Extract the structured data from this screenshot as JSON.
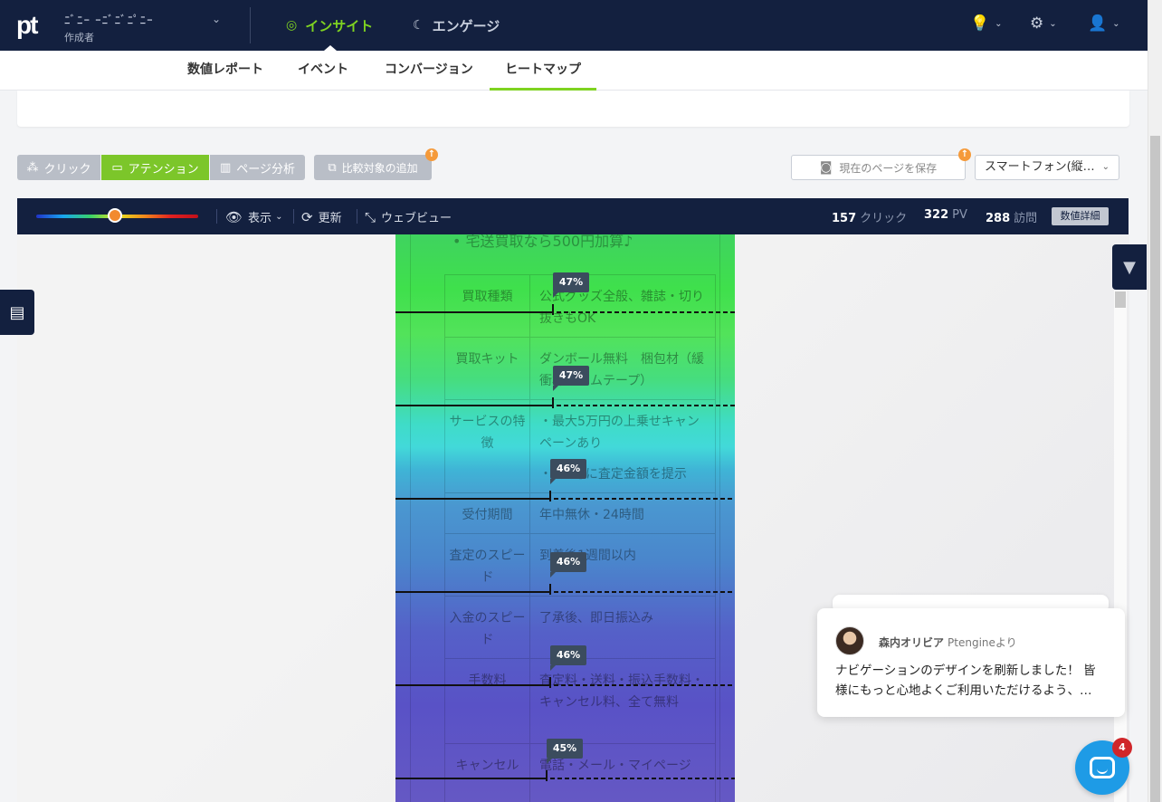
{
  "app": {
    "logo": "pt",
    "site_name": "ﾆﾞﾆｰ ｰﾆﾞﾆﾞﾆﾟﾆｰ",
    "site_role": "作成者"
  },
  "topnav": {
    "insight": "インサイト",
    "engage": "エンゲージ",
    "icons": [
      "lightbulb-icon",
      "gear-icon",
      "user-icon"
    ]
  },
  "subnav": {
    "tabs": [
      "数値レポート",
      "イベント",
      "コンバージョン",
      "ヒートマップ"
    ],
    "active": "ヒートマップ"
  },
  "toolbar": {
    "click": "クリック",
    "attention": "アテンション",
    "page_analysis": "ページ分析",
    "compare": "比較対象の追加",
    "save": "現在のページを保存",
    "device": "スマートフォン(縦…"
  },
  "heatbar": {
    "display": "表示",
    "refresh": "更新",
    "webview": "ウェブビュー",
    "stats": {
      "clicks_value": "157",
      "clicks_label": "クリック",
      "pv_value": "322",
      "pv_label": "PV",
      "visits_value": "288",
      "visits_label": "訪問"
    },
    "detail": "数値詳細"
  },
  "page": {
    "top_line": "• 宅送買取なら500円加算♪",
    "rows": [
      {
        "label": "買取種類",
        "value": "公式グッズ全般、雑誌・切り抜きもOK"
      },
      {
        "label": "買取キット",
        "value": "ダンボール無料　梱包材（緩衝材・ガムテープ）"
      },
      {
        "label": "サービスの特徴",
        "value": "・最大5万円の上乗せキャンペーンあり",
        "value2": "・1点毎に査定金額を提示"
      },
      {
        "label": "受付期間",
        "value": "年中無休・24時間"
      },
      {
        "label": "査定のスピード",
        "value": "到着後1週間以内"
      },
      {
        "label": "入金のスピード",
        "value": "了承後、即日振込み"
      },
      {
        "label": "手数料",
        "value": "査定料・送料・振込手数料・キャンセル料、全て無料"
      },
      {
        "label": "キャンセル",
        "value": "電話・メール・マイページ"
      }
    ],
    "folds": [
      "47%",
      "47%",
      "46%",
      "46%",
      "46%",
      "45%"
    ]
  },
  "chat": {
    "author": "森内オリビア",
    "via": "Ptengineより",
    "message": "ナビゲーションのデザインを刷新しました！ 皆様にもっと心地よくご利用いただけるよう、…",
    "unread": "4"
  },
  "colors": {
    "nav_bg": "#13203f",
    "accent_green": "#7fd321",
    "attention_btn": "#7cc62a",
    "launcher": "#1e9be6"
  }
}
